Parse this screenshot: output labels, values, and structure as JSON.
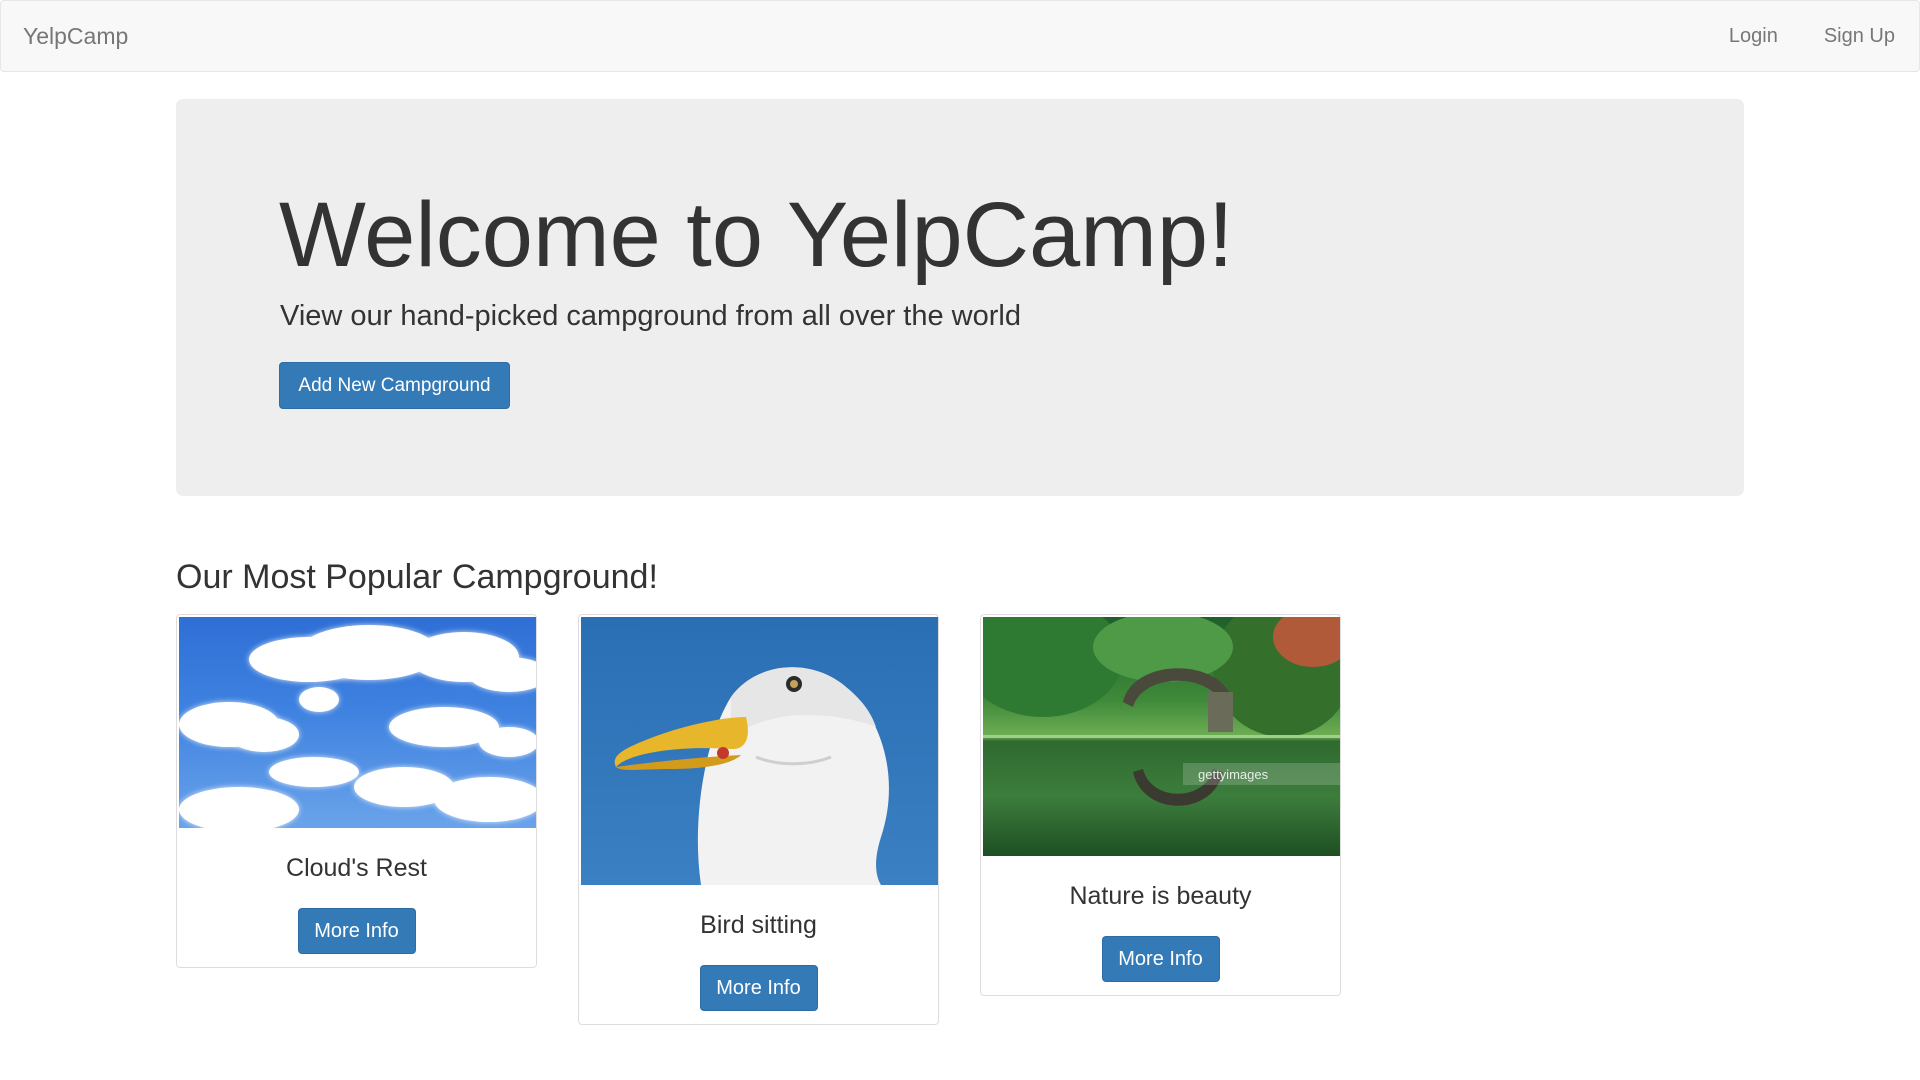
{
  "navbar": {
    "brand": "YelpCamp",
    "login": "Login",
    "signup": "Sign Up"
  },
  "jumbotron": {
    "title": "Welcome to YelpCamp!",
    "subtitle": "View our hand-picked campground from all over the world",
    "add_button": "Add New Campground"
  },
  "section": {
    "title": "Our Most Popular Campground!"
  },
  "cards": [
    {
      "caption": "Cloud's Rest",
      "button": "More Info",
      "image": "clouds-sky-photo"
    },
    {
      "caption": "Bird sitting",
      "button": "More Info",
      "image": "seagull-head-photo"
    },
    {
      "caption": "Nature is beauty",
      "button": "More Info",
      "image": "bridge-reflection-photo",
      "watermark": "gettyimages"
    }
  ],
  "colors": {
    "primary": "#337ab7",
    "navbar_bg": "#f8f8f8",
    "jumbotron_bg": "#eeeeee",
    "nav_text": "#777777"
  }
}
